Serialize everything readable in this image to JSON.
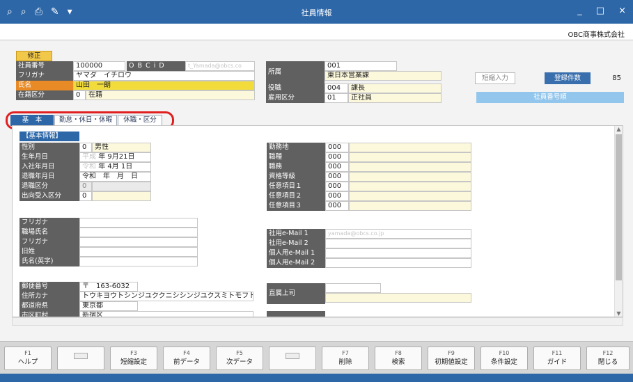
{
  "window": {
    "title": "社員情報",
    "company": "OBC商事株式会社",
    "toolbar_icons": [
      "search-plus-icon",
      "search-doc-icon",
      "print-icon",
      "tool-icon",
      "dropdown-icon"
    ],
    "controls": {
      "minimize": "_",
      "maximize": "□",
      "close": "×"
    }
  },
  "status": {
    "mode": "修正"
  },
  "header": {
    "emp_no_label": "社員番号",
    "emp_no": "100000",
    "obcid_label": "O B C i D",
    "obcid": "t_Yamada@obcs.co",
    "kana_label": "フリガナ",
    "kana": "ヤマダ　イチロウ",
    "name_label": "氏名",
    "name": "山田　一朗",
    "status_label": "在籍区分",
    "status_code": "0",
    "status_text": "在籍",
    "dept_label": "所属",
    "dept_code": "001",
    "dept_name": "東日本営業課",
    "post_label": "役職",
    "post_code": "004",
    "post_name": "課長",
    "employ_label": "雇用区分",
    "employ_code": "01",
    "employ_name": "正社員"
  },
  "side": {
    "short_input": "短縮入力",
    "reg_count_label": "登録件数",
    "reg_count": "85",
    "sort_order": "社員番号順"
  },
  "tabs": [
    {
      "label": "基　本",
      "active": true
    },
    {
      "label": "勤怠・休日・休暇",
      "active": false
    },
    {
      "label": "休職・区分",
      "active": false
    }
  ],
  "basic": {
    "section": "【基本情報】",
    "gender_label": "性別",
    "gender_code": "0",
    "gender": "男性",
    "birth_label": "生年月日",
    "birth_era": "平成",
    "birth": "年 9月21日",
    "join_label": "入社年月日",
    "join_era": "令和",
    "join": "年 4月 1日",
    "leave_label": "退職年月日",
    "leave": "令和　年　月　日",
    "leave_type_label": "退職区分",
    "leave_type": "0",
    "transfer_label": "出向受入区分",
    "transfer": "0",
    "workplace_label": "勤務地",
    "workplace": "000",
    "job_type_label": "職種",
    "job_type": "000",
    "duty_label": "職務",
    "duty": "000",
    "grade_label": "資格等級",
    "grade": "000",
    "opt1_label": "任意項目１",
    "opt1": "000",
    "opt2_label": "任意項目２",
    "opt2": "000",
    "opt3_label": "任意項目３",
    "opt3": "000",
    "kana2_label": "フリガナ",
    "work_name_label": "職場氏名",
    "kana3_label": "フリガナ",
    "old_name_label": "旧姓",
    "name_en_label": "氏名(英字)",
    "mail1_label": "社用e-Mail 1",
    "mail1": "yamada@obcs.co.jp",
    "mail2_label": "社用e-Mail 2",
    "pmail1_label": "個人用e-Mail 1",
    "pmail2_label": "個人用e-Mail 2",
    "zip_label": "郵便番号",
    "zip": "〒　163-6032",
    "addr_kana_label": "住所カナ",
    "addr_kana": "トウキヨウトシンジユククニシシンジユクスミトモフト",
    "pref_label": "都道府県",
    "pref": "東京都",
    "city_label": "市区町村",
    "city": "新宿区",
    "boss_label": "直属上司"
  },
  "fkeys": [
    {
      "key": "F1",
      "label": "ヘルプ"
    },
    {
      "key": "",
      "label": ""
    },
    {
      "key": "F3",
      "label": "短縮設定"
    },
    {
      "key": "F4",
      "label": "前データ"
    },
    {
      "key": "F5",
      "label": "次データ"
    },
    {
      "key": "",
      "label": ""
    },
    {
      "key": "F7",
      "label": "削除"
    },
    {
      "key": "F8",
      "label": "検索"
    },
    {
      "key": "F9",
      "label": "初期値設定"
    },
    {
      "key": "F10",
      "label": "条件設定"
    },
    {
      "key": "F11",
      "label": "ガイド"
    },
    {
      "key": "F12",
      "label": "閉じる"
    }
  ],
  "colors": {
    "titlebar": "#2d67a8",
    "tab_active": "#2d67a8",
    "highlight": "#e02020",
    "edit_badge": "#f2c84a"
  }
}
